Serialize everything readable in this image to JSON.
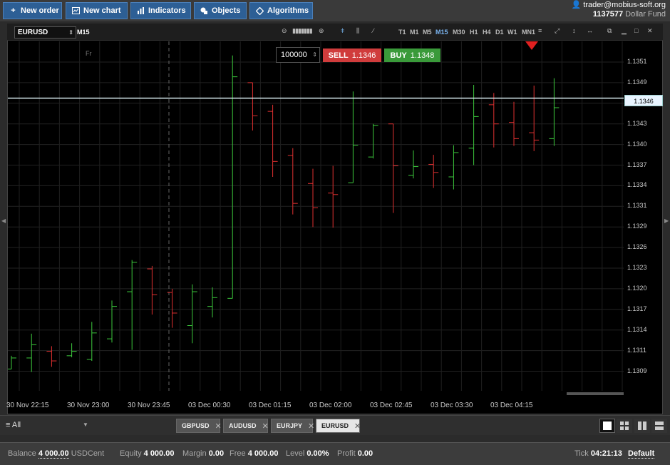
{
  "toolbar": {
    "new_order": "New order",
    "new_chart": "New chart",
    "indicators": "Indicators",
    "objects": "Objects",
    "algorithms": "Algorithms"
  },
  "account": {
    "user": "trader@mobius-soft.org",
    "number": "1137577",
    "fund": "Dollar Fund"
  },
  "chart_toolbar": {
    "symbol": "EURUSD",
    "timeframe": "M15",
    "timeframes": [
      "T1",
      "M1",
      "M5",
      "M15",
      "M30",
      "H1",
      "H4",
      "D1",
      "W1",
      "MN1"
    ],
    "active_timeframe": "M15"
  },
  "trade_panel": {
    "quantity": "100000",
    "sell_label": "SELL",
    "sell_price": "1.1346",
    "buy_label": "BUY",
    "buy_price": "1.1348"
  },
  "chart_data": {
    "type": "ohlc",
    "symbol": "EURUSD",
    "timeframe": "M15",
    "current_price": "1.1346",
    "day_marker": "Fr",
    "y_ticks": [
      "1.1351",
      "1.1349",
      "1.1346",
      "1.1343",
      "1.1340",
      "1.1337",
      "1.1334",
      "1.1331",
      "1.1329",
      "1.1326",
      "1.1323",
      "1.1320",
      "1.1317",
      "1.1314",
      "1.1311",
      "1.1309"
    ],
    "x_ticks": [
      "30 Nov 22:15",
      "30 Nov 23:00",
      "30 Nov 23:45",
      "03 Dec 00:30",
      "03 Dec 01:15",
      "03 Dec 02:00",
      "03 Dec 02:45",
      "03 Dec 03:30",
      "03 Dec 04:15"
    ],
    "ylim": [
      1.13075,
      1.13525
    ],
    "bars": [
      {
        "o": 1.13093,
        "h": 1.13111,
        "l": 1.13093,
        "c": 1.13108
      },
      {
        "o": 1.13108,
        "h": 1.13141,
        "l": 1.13089,
        "c": 1.13126
      },
      {
        "o": 1.13117,
        "h": 1.13124,
        "l": 1.13096,
        "c": 1.13104
      },
      {
        "o": 1.13111,
        "h": 1.13128,
        "l": 1.13109,
        "c": 1.13117
      },
      {
        "o": 1.13106,
        "h": 1.13157,
        "l": 1.13104,
        "c": 1.13142
      },
      {
        "o": 1.13134,
        "h": 1.13186,
        "l": 1.13129,
        "c": 1.13178
      },
      {
        "o": 1.13198,
        "h": 1.13241,
        "l": 1.13119,
        "c": 1.13238
      },
      {
        "o": 1.13229,
        "h": 1.13233,
        "l": 1.13167,
        "c": 1.13194
      },
      {
        "o": 1.13197,
        "h": 1.13202,
        "l": 1.13149,
        "c": 1.13169
      },
      {
        "o": 1.13152,
        "h": 1.13208,
        "l": 1.13128,
        "c": 1.13198
      },
      {
        "o": 1.13178,
        "h": 1.13204,
        "l": 1.13163,
        "c": 1.1319
      },
      {
        "o": 1.13189,
        "h": 1.13519,
        "l": 1.1336,
        "c": 1.1349
      },
      {
        "o": 1.13482,
        "h": 1.13479,
        "l": 1.13417,
        "c": 1.13437
      },
      {
        "o": 1.13443,
        "h": 1.13452,
        "l": 1.13354,
        "c": 1.13375
      },
      {
        "o": 1.13383,
        "h": 1.13393,
        "l": 1.13303,
        "c": 1.13318
      },
      {
        "o": 1.13345,
        "h": 1.13365,
        "l": 1.13286,
        "c": 1.13312
      },
      {
        "o": 1.13332,
        "h": 1.13369,
        "l": 1.13285,
        "c": 1.1333
      },
      {
        "o": 1.13346,
        "h": 1.1347,
        "l": 1.1336,
        "c": 1.13397
      },
      {
        "o": 1.13381,
        "h": 1.13426,
        "l": 1.13379,
        "c": 1.13424
      },
      {
        "o": 1.13426,
        "h": 1.13425,
        "l": 1.13305,
        "c": 1.13369
      },
      {
        "o": 1.13356,
        "h": 1.1339,
        "l": 1.13352,
        "c": 1.13368
      },
      {
        "o": 1.13371,
        "h": 1.13384,
        "l": 1.13339,
        "c": 1.1336
      },
      {
        "o": 1.13354,
        "h": 1.13397,
        "l": 1.13337,
        "c": 1.13387
      },
      {
        "o": 1.13393,
        "h": 1.13479,
        "l": 1.1337,
        "c": 1.13436
      },
      {
        "o": 1.13452,
        "h": 1.13468,
        "l": 1.13394,
        "c": 1.13426
      },
      {
        "o": 1.13428,
        "h": 1.13456,
        "l": 1.13396,
        "c": 1.13406
      },
      {
        "o": 1.13414,
        "h": 1.13478,
        "l": 1.13389,
        "c": 1.13404
      },
      {
        "o": 1.13406,
        "h": 1.13488,
        "l": 1.13396,
        "c": 1.13448
      }
    ]
  },
  "tabs_bar": {
    "filter": "All",
    "tabs": [
      {
        "label": "GBPUSD",
        "close": "✕"
      },
      {
        "label": "AUDUSD",
        "close": "✕"
      },
      {
        "label": "EURJPY",
        "close": "✕"
      },
      {
        "label": "EURUSD",
        "close": "✕"
      }
    ],
    "active_tab": "EURUSD"
  },
  "status": {
    "balance_label": "Balance",
    "balance_value": "4 000.00",
    "balance_currency": "USDCent",
    "equity_label": "Equity",
    "equity_value": "4 000.00",
    "margin_label": "Margin",
    "margin_value": "0.00",
    "free_label": "Free",
    "free_value": "4 000.00",
    "level_label": "Level",
    "level_value": "0.00%",
    "profit_label": "Profit",
    "profit_value": "0.00",
    "tick_label": "Tick",
    "tick_value": "04:21:13",
    "profile": "Default"
  },
  "colors": {
    "up": "#3cc83c",
    "down": "#e03030",
    "accent": "#2d5f95"
  }
}
